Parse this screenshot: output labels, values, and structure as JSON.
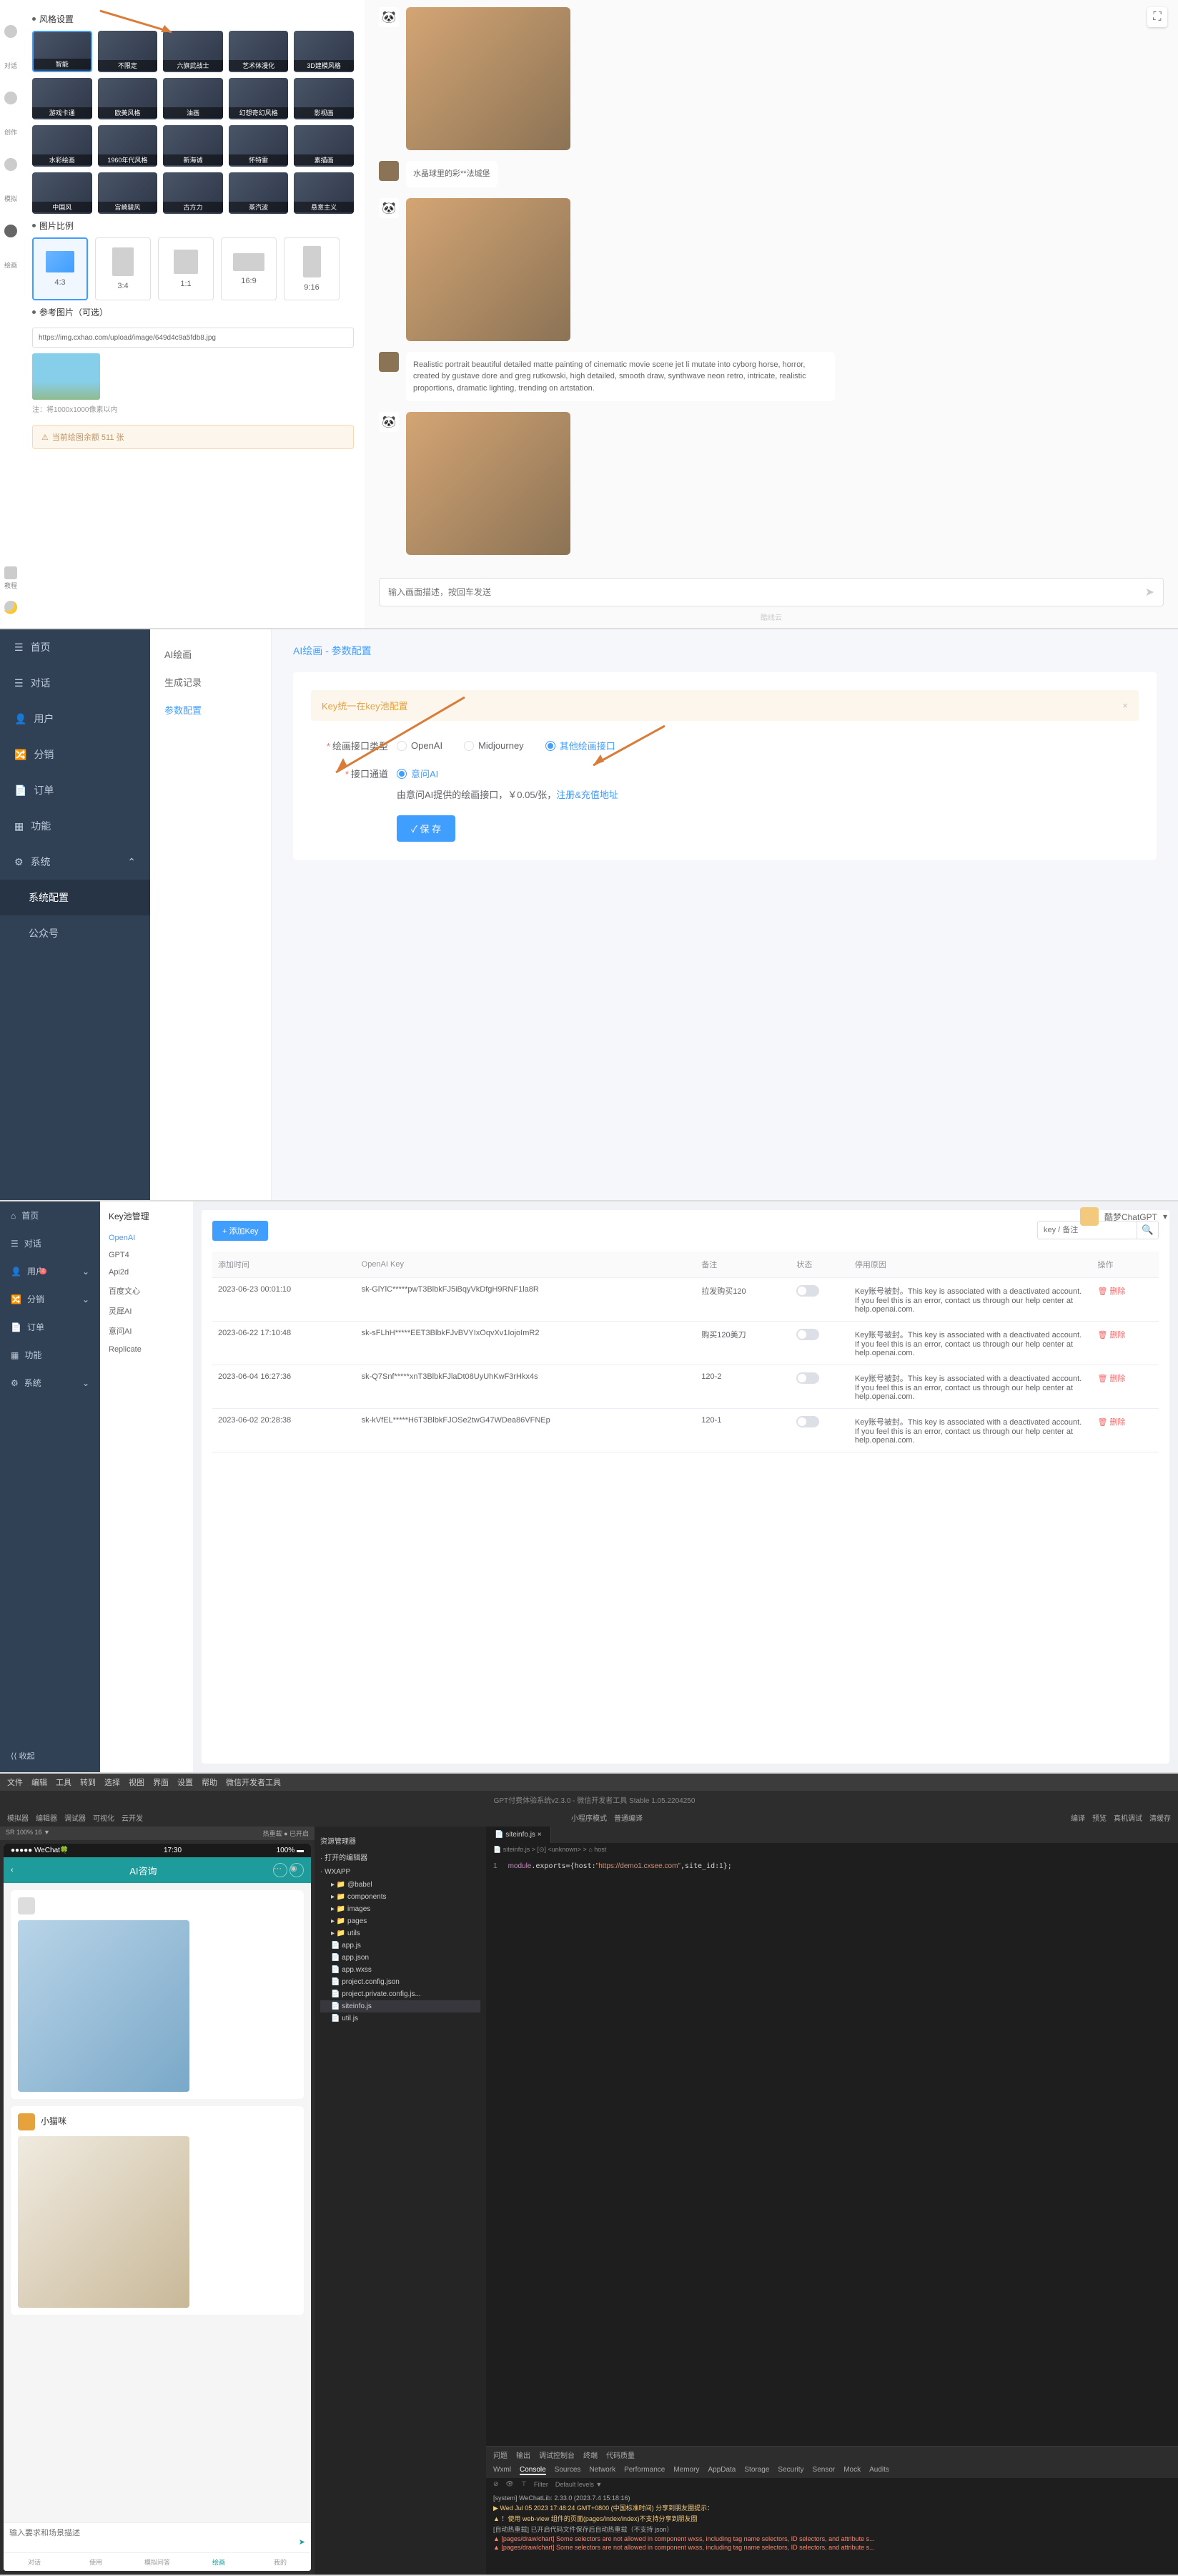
{
  "s1": {
    "icons": [
      {
        "label": "对话"
      },
      {
        "label": "创作"
      },
      {
        "label": "模拟"
      },
      {
        "label": "绘画"
      }
    ],
    "bottom_icons": [
      {
        "label": "教程"
      }
    ],
    "style_title": "风格设置",
    "styles": [
      "智能",
      "不限定",
      "六旗武战士",
      "艺术体漫化",
      "3D建模风格",
      "游戏卡通",
      "欧美风格",
      "油画",
      "幻想奇幻风格",
      "影视画",
      "水彩绘画",
      "1960年代风格",
      "新海诚",
      "怀特雷",
      "素描画",
      "中国风",
      "宫崎骏风",
      "古方力",
      "蒸汽波",
      "悬意主义"
    ],
    "ratio_title": "图片比例",
    "ratios": [
      "4:3",
      "3:4",
      "1:1",
      "16:9",
      "9:16"
    ],
    "ref_title": "参考图片（可选）",
    "ref_url": "https://img.cxhao.com/upload/image/649d4c9a5fdb8.jpg",
    "ref_note": "注：将1000x1000像素以内",
    "credit_text": "当前绘图余额 511 张",
    "chat": [
      {
        "type": "img"
      },
      {
        "type": "txt",
        "text": "水晶球里的彩**法城堡"
      },
      {
        "type": "img"
      },
      {
        "type": "txt",
        "text": "Realistic portrait beautiful detailed matte painting of cinematic movie scene jet li mutate into cyborg horse, horror, created by gustave dore and greg rutkowski, high detailed, smooth draw, synthwave neon retro, intricate, realistic proportions, dramatic lighting, trending on artstation."
      },
      {
        "type": "img"
      }
    ],
    "input_ph": "输入画面描述，按回车发送",
    "brand": "酷线云"
  },
  "s2": {
    "nav": [
      "首页",
      "对话",
      "用户",
      "分销",
      "订单",
      "功能",
      "系统"
    ],
    "nav_sub": [
      "系统配置",
      "公众号"
    ],
    "sub": [
      "AI绘画",
      "生成记录",
      "参数配置"
    ],
    "title": "AI绘画 - 参数配置",
    "alert": "Key统一在key池配置",
    "f1_label": "绘画接口类型",
    "f1_opts": [
      "OpenAI",
      "Midjourney",
      "其他绘画接口"
    ],
    "f2_label": "接口通道",
    "f2_opts": [
      "意问AI"
    ],
    "desc_pre": "由意问AI提供的绘画接口，￥0.05/张，",
    "desc_link": "注册&充值地址",
    "save": "✓ 保 存"
  },
  "s3": {
    "user": "酷梦ChatGPT",
    "nav": [
      "首页",
      "对话",
      "用户",
      "分销",
      "订单",
      "功能",
      "系统"
    ],
    "collapse": "⟨⟨ 收起",
    "sub_title": "Key池管理",
    "sub": [
      "OpenAI",
      "GPT4",
      "Api2d",
      "百度文心",
      "灵犀AI",
      "意问AI",
      "Replicate"
    ],
    "add": "+ 添加Key",
    "search_ph": "key / 备注",
    "cols": [
      "添加时间",
      "OpenAI Key",
      "备注",
      "状态",
      "停用原因",
      "操作"
    ],
    "rows": [
      {
        "time": "2023-06-23 00:01:10",
        "key": "sk-GlYlC*****pwT3BlbkFJ5iBqyVkDfgH9RNF1la8R",
        "note": "拉发购买120",
        "reason": "Key账号被封。This key is associated with a deactivated account. If you feel this is an error, contact us through our help center at help.openai.com."
      },
      {
        "time": "2023-06-22 17:10:48",
        "key": "sk-sFLhH*****EET3BlbkFJvBVYIxOqvXv1IojoImR2",
        "note": "购买120美刀",
        "reason": "Key账号被封。This key is associated with a deactivated account. If you feel this is an error, contact us through our help center at help.openai.com."
      },
      {
        "time": "2023-06-04 16:27:36",
        "key": "sk-Q7Snf*****xnT3BlbkFJlaDt08UyUhKwF3rHkx4s",
        "note": "120-2",
        "reason": "Key账号被封。This key is associated with a deactivated account. If you feel this is an error, contact us through our help center at help.openai.com."
      },
      {
        "time": "2023-06-02 20:28:38",
        "key": "sk-kVfEL*****H6T3BlbkFJOSe2twG47WDea86VFNEp",
        "note": "120-1",
        "reason": "Key账号被封。This key is associated with a deactivated account. If you feel this is an error, contact us through our help center at help.openai.com."
      }
    ],
    "del": "🗑 删除"
  },
  "s4": {
    "menu": [
      "文件",
      "编辑",
      "工具",
      "转到",
      "选择",
      "视图",
      "界面",
      "设置",
      "帮助",
      "微信开发者工具"
    ],
    "title": "GPT付费体验系统v2.3.0 - 微信开发者工具 Stable 1.05.2204250",
    "toolbar": {
      "left": [
        "模拟器",
        "编辑器",
        "调试器",
        "可视化",
        "云开发"
      ],
      "mid": [
        "小程序模式",
        "普通编译"
      ],
      "right": [
        "编译",
        "预览",
        "真机调试",
        "清缓存"
      ]
    },
    "sim_bar": "SR 100% 16 ▼",
    "sim_bar_r": "热重载 ● 已开启",
    "phone": {
      "status_l": "●●●●● WeChat🍀",
      "status_time": "17:30",
      "status_r": "100% ▬",
      "header": "AI咨询",
      "card2_name": "小猫咪",
      "input_ph": "输入要求和场景描述",
      "tabs": [
        "对话",
        "使用",
        "模拟问答",
        "绘画",
        "我的"
      ]
    },
    "files": {
      "hd1": "资源管理器",
      "hd2": "· 打开的编辑器",
      "hd3": "· WXAPP",
      "items": [
        "@babel",
        "components",
        "images",
        "pages",
        "utils",
        "app.js",
        "app.json",
        "app.wxss",
        "project.config.json",
        "project.private.config.js...",
        "siteinfo.js",
        "util.js"
      ]
    },
    "editor": {
      "tab": "siteinfo.js",
      "crumb": "📄 siteinfo.js > [⊙] <unknown> > ⌂ host",
      "code": "module.exports={host:\"https://demo1.cxsee.com\",site_id:1};"
    },
    "dev": {
      "tabs_top": [
        "问题",
        "输出",
        "调试控制台",
        "终端",
        "代码质量"
      ],
      "tabs": [
        "Wxml",
        "Console",
        "Sources",
        "Network",
        "Performance",
        "Memory",
        "AppData",
        "Storage",
        "Security",
        "Sensor",
        "Mock",
        "Audits"
      ],
      "sub": [
        "⊘",
        "👁",
        "⊤",
        "Filter",
        "Default levels ▼"
      ],
      "logs": [
        {
          "cls": "sys",
          "text": "[system] WeChatLib: 2.33.0 (2023.7.4 15:18:16)"
        },
        {
          "cls": "warn",
          "text": "▶ Wed Jul 05 2023 17:48:24 GMT+0800 (中国标准时间) 分享到朋友圈提示："
        },
        {
          "cls": "warn",
          "text": "▲ ！使用 web-view 组件的页面(pages/index/index)不支持分享到朋友圈"
        },
        {
          "cls": "sys",
          "text": "[自动热重载] 已开启代码文件保存后自动热重载（不支持 json）"
        },
        {
          "cls": "err",
          "text": "▲ [pages/draw/chart] Some selectors are not allowed in component wxss, including tag name selectors, ID selectors, and attribute s..."
        },
        {
          "cls": "err",
          "text": "▲ [pages/draw/chart] Some selectors are not allowed in component wxss, including tag name selectors, ID selectors, and attribute s..."
        }
      ]
    }
  }
}
